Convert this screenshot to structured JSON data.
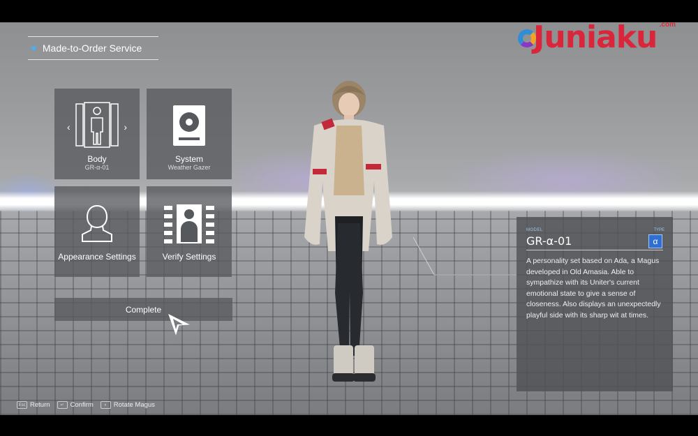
{
  "header": {
    "title": "Made-to-Order Service"
  },
  "logo": {
    "text": "Juniaku",
    "suffix": ".com"
  },
  "menu": {
    "body": {
      "label": "Body",
      "value": "GR-α-01"
    },
    "system": {
      "label": "System",
      "value": "Weather Gazer"
    },
    "appearance": {
      "label": "Appearance Settings"
    },
    "verify": {
      "label": "Verify Settings"
    },
    "complete": {
      "label": "Complete"
    }
  },
  "info_panel": {
    "model_label": "MODEL",
    "type_label": "TYPE",
    "model_name": "GR-α-01",
    "type_badge": "α",
    "description": "A personality set based on Ada, a Magus developed in Old Amasia. Able to sympathize with its Uniter's current emotional state to give a sense of closeness. Also displays an unexpectedly playful side with its sharp wit at times."
  },
  "footer": {
    "items": [
      {
        "key": "Esc",
        "label": "Return"
      },
      {
        "key": "↵",
        "label": "Confirm"
      },
      {
        "key": "◐",
        "label": "Rotate Magus"
      }
    ]
  },
  "colors": {
    "accent": "#3fb4ff",
    "logo_red": "#d9263a",
    "badge_blue": "#2e6fd1"
  }
}
